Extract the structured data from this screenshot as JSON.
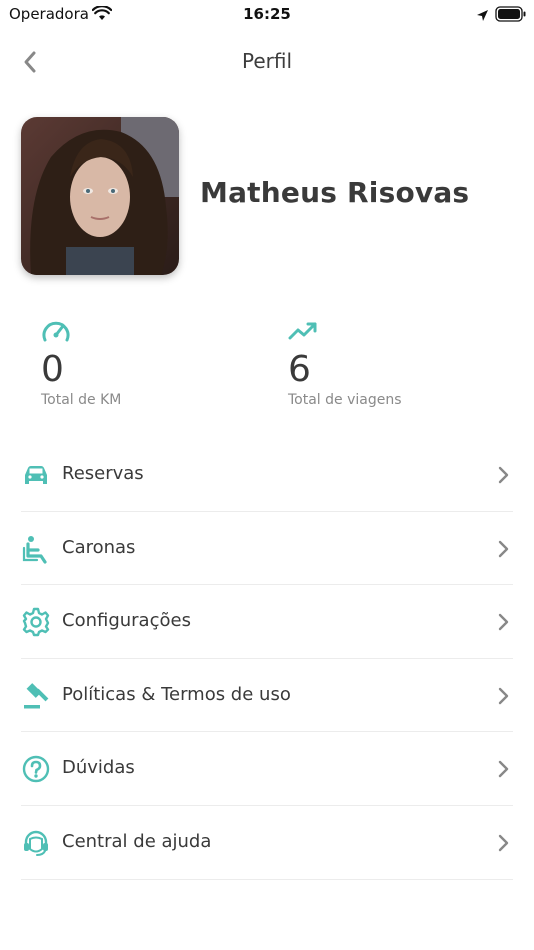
{
  "status_bar": {
    "carrier": "Operadora",
    "time": "16:25"
  },
  "nav": {
    "title": "Perfil"
  },
  "profile": {
    "name": "Matheus Risovas"
  },
  "stats": {
    "km": {
      "value": "0",
      "label": "Total de KM",
      "icon": "speedometer-icon"
    },
    "trips": {
      "value": "6",
      "label": "Total de viagens",
      "icon": "trending-up-icon"
    }
  },
  "menu": {
    "items": [
      {
        "label": "Reservas",
        "icon": "car-icon"
      },
      {
        "label": "Caronas",
        "icon": "seat-icon"
      },
      {
        "label": "Configurações",
        "icon": "gear-icon"
      },
      {
        "label": "Políticas & Termos de uso",
        "icon": "gavel-icon"
      },
      {
        "label": "Dúvidas",
        "icon": "question-icon"
      },
      {
        "label": "Central de ajuda",
        "icon": "headset-icon"
      }
    ]
  },
  "colors": {
    "accent": "#4fbfb5",
    "text": "#3a3a3a",
    "muted": "#8a8a8a",
    "chevron": "#888888"
  }
}
